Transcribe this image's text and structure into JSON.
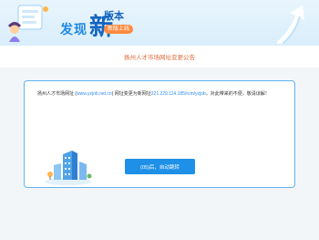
{
  "banner": {
    "pre_text": "发现",
    "big_char": "新",
    "suffix": "版本",
    "pill": "新版上线"
  },
  "notice": {
    "title": "扬州人才市场网址变更公告"
  },
  "card": {
    "msg_part1": "扬州人才市场网址 (",
    "old_url": "www.yzjob.net.cn",
    "msg_part2": ") 网址变更为新网址",
    "new_url": "221.229.114.185/rcm/yzjob",
    "msg_part3": "，对此带来的不便，敬请谅解！",
    "button_label": "(05)后，自动跳转"
  },
  "colors": {
    "accent": "#1e90e8",
    "notice": "#e06b3a",
    "card_border": "#61b3f0"
  }
}
